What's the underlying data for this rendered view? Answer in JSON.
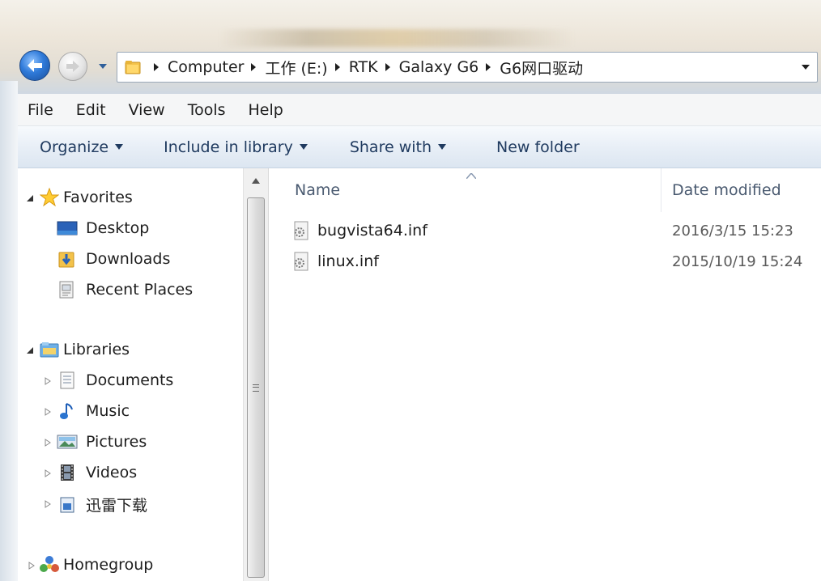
{
  "address": {
    "crumbs": [
      "Computer",
      "工作 (E:)",
      "RTK",
      "Galaxy G6",
      "G6网口驱动"
    ]
  },
  "menu": [
    "File",
    "Edit",
    "View",
    "Tools",
    "Help"
  ],
  "toolbar": {
    "organize": "Organize",
    "include": "Include in library",
    "share": "Share with",
    "new_folder": "New folder"
  },
  "nav": {
    "favorites": {
      "label": "Favorites",
      "items": [
        "Desktop",
        "Downloads",
        "Recent Places"
      ]
    },
    "libraries": {
      "label": "Libraries",
      "items": [
        "Documents",
        "Music",
        "Pictures",
        "Videos",
        "迅雷下载"
      ]
    },
    "homegroup": "Homegroup"
  },
  "columns": {
    "name": "Name",
    "date": "Date modified"
  },
  "files": [
    {
      "name": "bugvista64.inf",
      "date": "2016/3/15 15:23"
    },
    {
      "name": "linux.inf",
      "date": "2015/10/19 15:24"
    }
  ],
  "colors": {
    "accent": "#2f7ad9",
    "toolbar_text": "#1f3a5f"
  }
}
